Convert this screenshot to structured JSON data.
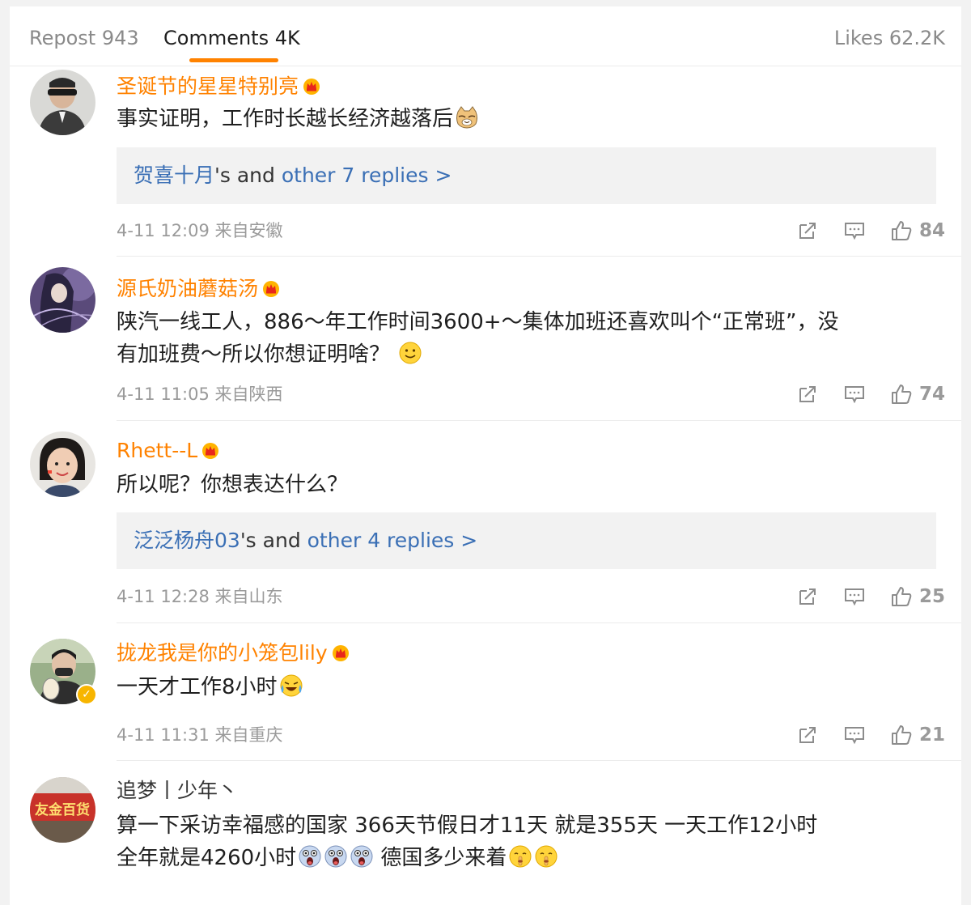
{
  "tabs": {
    "repost": "Repost 943",
    "comments": "Comments 4K",
    "likes": "Likes 62.2K"
  },
  "colors": {
    "accent": "#ff8200",
    "link": "#3a6fb5",
    "meta": "#9a9a9a"
  },
  "comments": [
    {
      "username": "圣诞节的星星特别亮",
      "text_lines": [
        "事实证明，工作时长越长经济越落后"
      ],
      "replies": {
        "name": "贺喜十月",
        "mid": "'s and ",
        "link": "other 7 replies >"
      },
      "meta": "4-11 12:09  来自安徽",
      "likes": "84"
    },
    {
      "username": "源氏奶油蘑菇汤",
      "text_lines": [
        "陕汽一线工人，886～年工作时间3600+～集体加班还喜欢叫个“正常班”，没",
        "有加班费～所以你想证明啥？"
      ],
      "meta": "4-11 11:05  来自陕西",
      "likes": "74"
    },
    {
      "username": "Rhett--L",
      "text_lines": [
        "所以呢？你想表达什么？"
      ],
      "replies": {
        "name": "泛泛杨舟03",
        "mid": "'s and ",
        "link": "other 4 replies >"
      },
      "meta": "4-11 12:28  来自山东",
      "likes": "25"
    },
    {
      "username": "拢龙我是你的小笼包lily",
      "text_lines": [
        "一天才工作8小时"
      ],
      "meta": "4-11 11:31  来自重庆",
      "likes": "21"
    },
    {
      "username": "追梦丨少年丶",
      "text_lines": [
        "算一下采访幸福感的国家  366天节假日才11天  就是355天   一天工作12小时",
        "全年就是4260小时",
        "   德国多少来着"
      ]
    }
  ],
  "avatar_text": {
    "c5": "友金百货"
  },
  "icons": [
    "vip-crown-icon",
    "share-icon",
    "comment-icon",
    "like-icon",
    "verified-badge-icon",
    "cat-emoji",
    "smile-emoji",
    "laugh-cry-emoji",
    "shocked-emoji",
    "shush-emoji"
  ]
}
